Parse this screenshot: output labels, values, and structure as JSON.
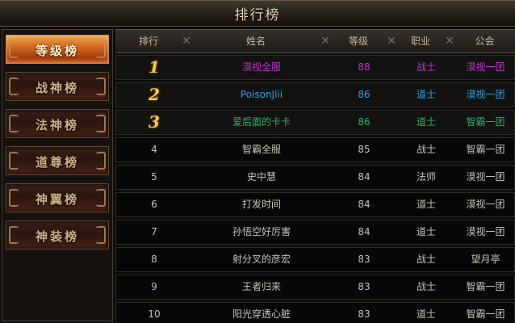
{
  "window": {
    "title": "排行榜"
  },
  "sidebar": {
    "tabs": [
      {
        "label": "等级榜",
        "active": true
      },
      {
        "label": "战神榜",
        "active": false
      },
      {
        "label": "法神榜",
        "active": false
      },
      {
        "label": "道尊榜",
        "active": false
      },
      {
        "label": "神翼榜",
        "active": false
      },
      {
        "label": "神装榜",
        "active": false
      }
    ]
  },
  "table": {
    "headers": {
      "rank": "排行",
      "name": "姓名",
      "level": "等级",
      "job": "职业",
      "guild": "公会"
    },
    "rows": [
      {
        "rank": "1",
        "name": "漠视全服",
        "level": "88",
        "job": "战士",
        "guild": "漠视一团",
        "color": "#c030c8"
      },
      {
        "rank": "2",
        "name": "PoisonJlii",
        "level": "86",
        "job": "道士",
        "guild": "漠视一团",
        "color": "#2f9fe0"
      },
      {
        "rank": "3",
        "name": "爱后面的卡卡",
        "level": "86",
        "job": "道士",
        "guild": "智霸一团",
        "color": "#2fb060"
      },
      {
        "rank": "4",
        "name": "智霸全服",
        "level": "85",
        "job": "战士",
        "guild": "智霸一团",
        "color": "#c8c2b6"
      },
      {
        "rank": "5",
        "name": "史中慧",
        "level": "84",
        "job": "法师",
        "guild": "漠视一团",
        "color": "#c8c2b6"
      },
      {
        "rank": "6",
        "name": "打发时间",
        "level": "84",
        "job": "道士",
        "guild": "漠视一团",
        "color": "#c8c2b6"
      },
      {
        "rank": "7",
        "name": "孙悟空好厉害",
        "level": "84",
        "job": "道士",
        "guild": "漠视一团",
        "color": "#c8c2b6"
      },
      {
        "rank": "8",
        "name": "射分叉的彦宏",
        "level": "83",
        "job": "战士",
        "guild": "望月亭",
        "color": "#c8c2b6"
      },
      {
        "rank": "9",
        "name": "王者归来",
        "level": "83",
        "job": "战士",
        "guild": "智霸一团",
        "color": "#c8c2b6"
      },
      {
        "rank": "10",
        "name": "阳光穿透心脏",
        "level": "83",
        "job": "道士",
        "guild": "智霸一团",
        "color": "#c8c2b6"
      }
    ]
  }
}
